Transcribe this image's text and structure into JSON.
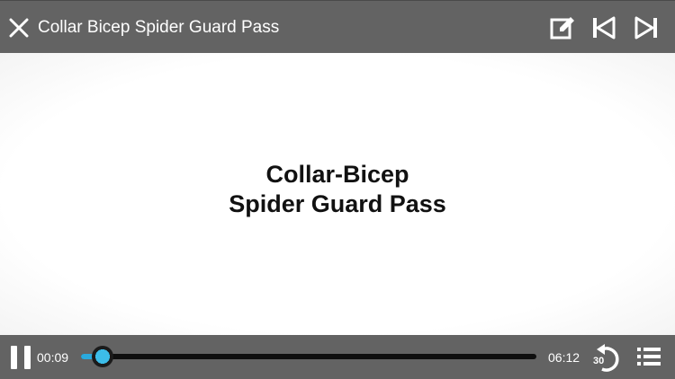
{
  "header": {
    "title": "Collar Bicep Spider Guard Pass",
    "close_icon": "close-icon",
    "edit_icon": "edit-note-icon",
    "prev_icon": "skip-previous-icon",
    "next_icon": "skip-next-icon"
  },
  "video": {
    "title_line1": "Collar-Bicep",
    "title_line2": "Spider Guard Pass"
  },
  "player": {
    "elapsed": "00:09",
    "duration": "06:12",
    "progress_fraction": 0.024,
    "replay_label": "30",
    "pause_icon": "pause-icon",
    "replay_icon": "replay-30-icon",
    "playlist_icon": "list-icon",
    "accent_color": "#2aa9dc",
    "bar_color": "#636363"
  }
}
